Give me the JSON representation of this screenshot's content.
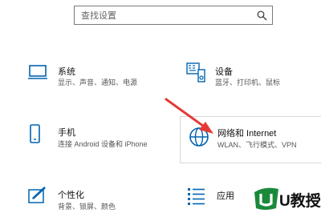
{
  "search": {
    "placeholder": "查找设置"
  },
  "tiles": {
    "system": {
      "title": "系统",
      "desc": "显示、声音、通知、电源",
      "icon": "monitor-icon"
    },
    "devices": {
      "title": "设备",
      "desc": "蓝牙、打印机、鼠标",
      "icon": "devices-icon"
    },
    "phone": {
      "title": "手机",
      "desc": "连接 Android 设备和 iPhone",
      "icon": "phone-icon"
    },
    "network": {
      "title": "网络和 Internet",
      "desc": "WLAN、飞行模式、VPN",
      "icon": "globe-icon"
    },
    "personal": {
      "title": "个性化",
      "desc": "背景、锁屏、颜色",
      "icon": "pen-icon"
    },
    "apps": {
      "title": "应用",
      "desc": "",
      "icon": "apps-list-icon"
    }
  },
  "watermark": {
    "text": "U教授"
  },
  "colors": {
    "accent": "#0063b1",
    "arrow": "#e53935",
    "logo_green": "#1a8a3a"
  }
}
